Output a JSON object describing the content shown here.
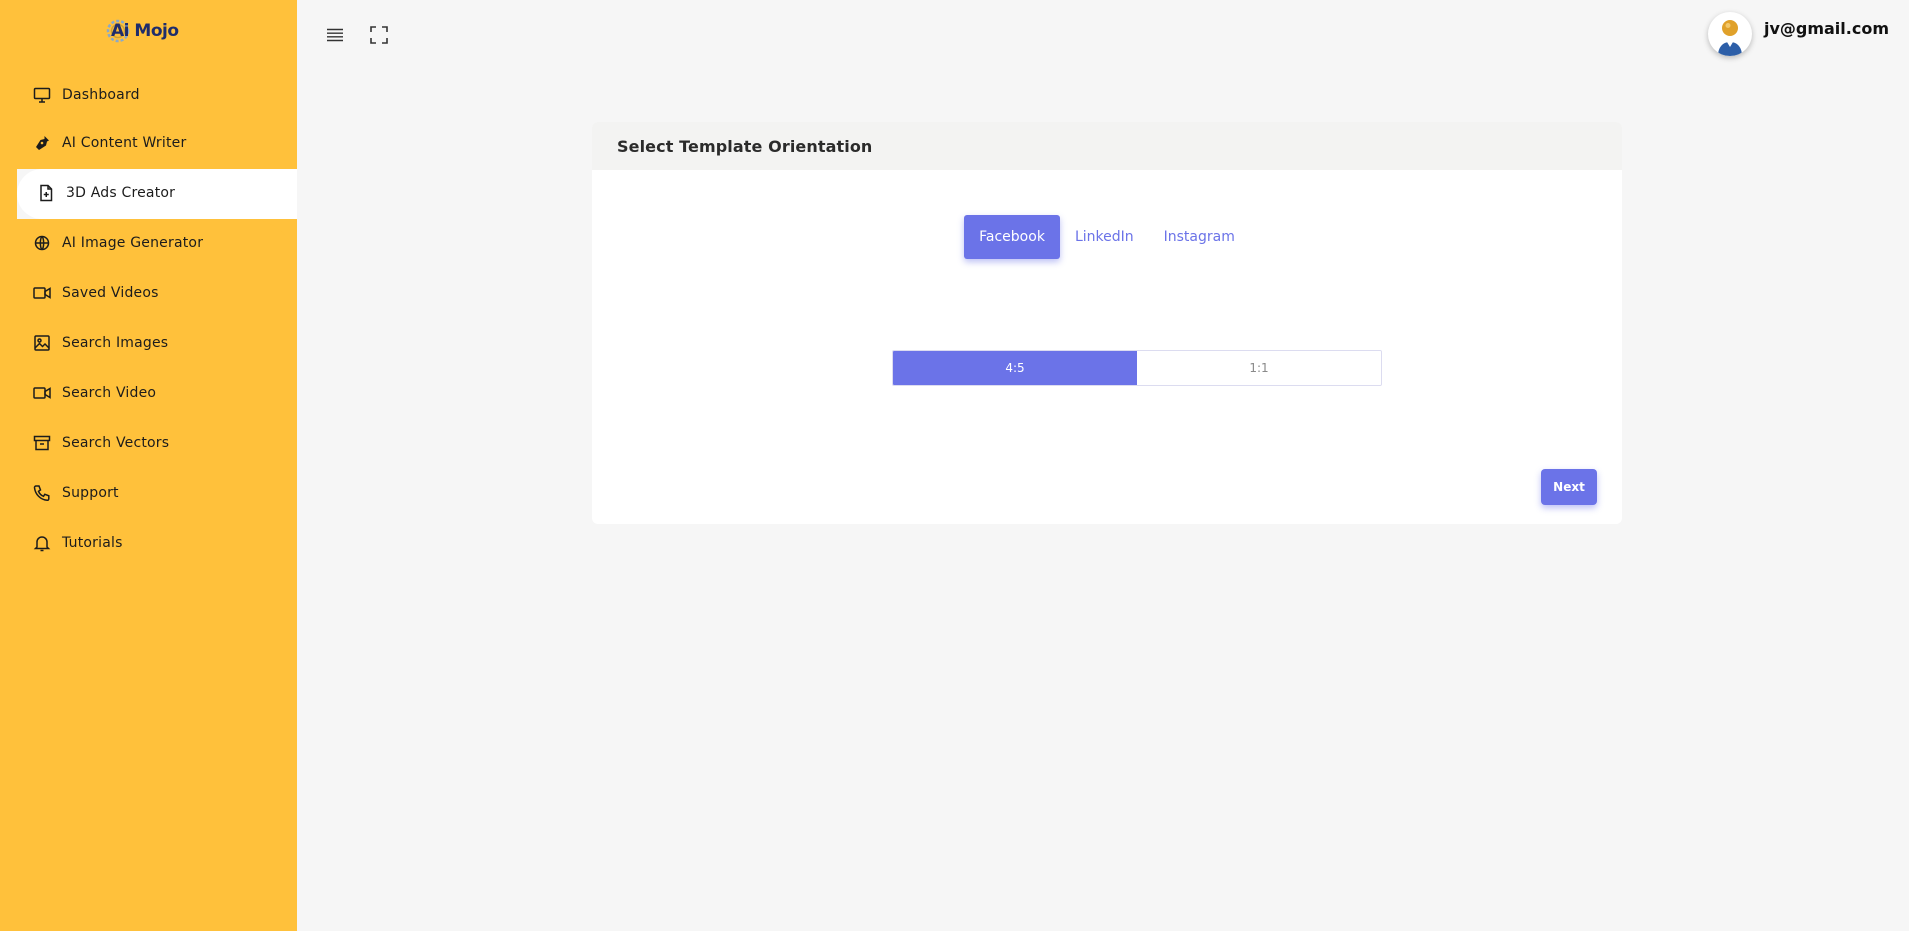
{
  "app": {
    "logo_text": "Ai Mojo"
  },
  "sidebar": {
    "items": [
      {
        "label": "Dashboard",
        "icon": "monitor-icon"
      },
      {
        "label": "AI Content Writer",
        "icon": "pen-nib-icon"
      },
      {
        "label": "3D Ads Creator",
        "icon": "file-plus-icon",
        "active": true
      },
      {
        "label": "AI Image Generator",
        "icon": "globe-icon"
      },
      {
        "label": "Saved Videos",
        "icon": "video-camera-icon"
      },
      {
        "label": "Search Images",
        "icon": "image-icon"
      },
      {
        "label": "Search Video",
        "icon": "video-camera-icon"
      },
      {
        "label": "Search Vectors",
        "icon": "archive-box-icon"
      },
      {
        "label": "Support",
        "icon": "phone-icon"
      },
      {
        "label": "Tutorials",
        "icon": "bell-icon"
      }
    ]
  },
  "topbar": {
    "user_email": "jv@gmail.com"
  },
  "card": {
    "title": "Select Template Orientation",
    "tabs": [
      {
        "label": "Facebook",
        "active": true
      },
      {
        "label": "LinkedIn",
        "active": false
      },
      {
        "label": "Instagram",
        "active": false
      }
    ],
    "ratios": [
      {
        "label": "4:5",
        "active": true
      },
      {
        "label": "1:1",
        "active": false
      }
    ],
    "next_label": "Next"
  },
  "colors": {
    "sidebar_bg": "#ffc13b",
    "accent": "#6b73e8",
    "page_bg": "#f6f6f6"
  }
}
